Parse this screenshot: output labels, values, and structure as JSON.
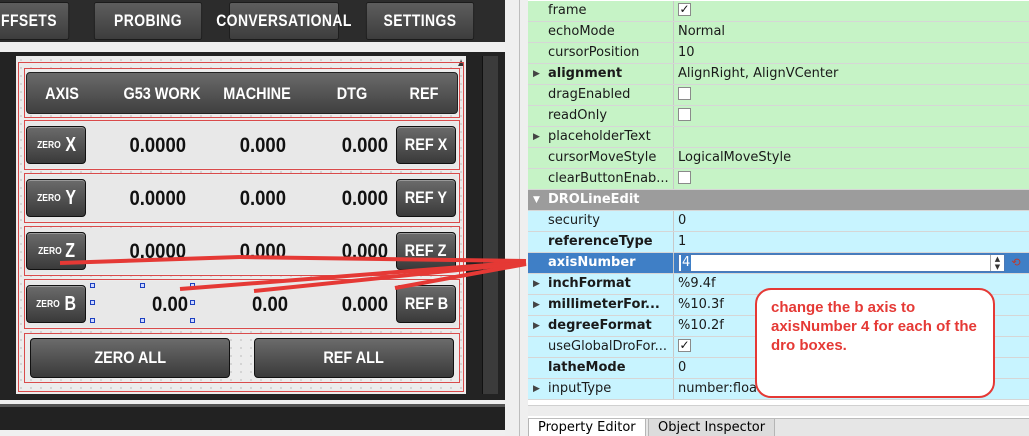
{
  "designer": {
    "tabs": [
      "FFSETS",
      "PROBING",
      "CONVERSATIONAL",
      "SETTINGS"
    ],
    "headers": [
      "AXIS",
      "G53 WORK",
      "MACHINE",
      "DTG",
      "REF"
    ],
    "rows": [
      {
        "zero_small": "ZERO",
        "zero_big": "X",
        "work": "0.0000",
        "machine": "0.000",
        "dtg": "0.000",
        "ref": "REF X"
      },
      {
        "zero_small": "ZERO",
        "zero_big": "Y",
        "work": "0.0000",
        "machine": "0.000",
        "dtg": "0.000",
        "ref": "REF Y"
      },
      {
        "zero_small": "ZERO",
        "zero_big": "Z",
        "work": "0.0000",
        "machine": "0.000",
        "dtg": "0.000",
        "ref": "REF Z"
      },
      {
        "zero_small": "ZERO",
        "zero_big": "B",
        "work": "0.00",
        "machine": "0.00",
        "dtg": "0.000",
        "ref": "REF B"
      }
    ],
    "zero_all": "ZERO ALL",
    "ref_all": "REF ALL"
  },
  "properties": {
    "rows": [
      {
        "name": "frame",
        "value": "",
        "check": "checked",
        "color": "green",
        "bold": false,
        "arrow": ""
      },
      {
        "name": "echoMode",
        "value": "Normal",
        "check": "",
        "color": "green",
        "bold": false,
        "arrow": ""
      },
      {
        "name": "cursorPosition",
        "value": "10",
        "check": "",
        "color": "green",
        "bold": false,
        "arrow": ""
      },
      {
        "name": "alignment",
        "value": "AlignRight, AlignVCenter",
        "check": "",
        "color": "green",
        "bold": true,
        "arrow": "▶"
      },
      {
        "name": "dragEnabled",
        "value": "",
        "check": "unchecked",
        "color": "green",
        "bold": false,
        "arrow": ""
      },
      {
        "name": "readOnly",
        "value": "",
        "check": "unchecked",
        "color": "green",
        "bold": false,
        "arrow": ""
      },
      {
        "name": "placeholderText",
        "value": "",
        "check": "",
        "color": "green",
        "bold": false,
        "arrow": "▶"
      },
      {
        "name": "cursorMoveStyle",
        "value": "LogicalMoveStyle",
        "check": "",
        "color": "green",
        "bold": false,
        "arrow": ""
      },
      {
        "name": "clearButtonEnab...",
        "value": "",
        "check": "unchecked",
        "color": "green",
        "bold": false,
        "arrow": ""
      }
    ],
    "group": "DROLineEdit",
    "group_rows": [
      {
        "name": "security",
        "value": "0",
        "check": "",
        "bold": false,
        "arrow": ""
      },
      {
        "name": "referenceType",
        "value": "1",
        "check": "",
        "bold": true,
        "arrow": ""
      }
    ],
    "selected": {
      "name": "axisNumber",
      "value": "4"
    },
    "after_rows": [
      {
        "name": "inchFormat",
        "value": "%9.4f",
        "check": "",
        "bold": true,
        "arrow": "▶"
      },
      {
        "name": "millimeterFor...",
        "value": "%10.3f",
        "check": "",
        "bold": true,
        "arrow": "▶"
      },
      {
        "name": "degreeFormat",
        "value": "%10.2f",
        "check": "",
        "bold": true,
        "arrow": "▶"
      },
      {
        "name": "useGlobalDroFor...",
        "value": "",
        "check": "checked",
        "bold": false,
        "arrow": ""
      },
      {
        "name": "latheMode",
        "value": "0",
        "check": "",
        "bold": true,
        "arrow": ""
      },
      {
        "name": "inputType",
        "value": "number:float",
        "check": "",
        "bold": false,
        "arrow": "▶"
      }
    ]
  },
  "annotation": "change the b axis to axisNumber 4 for each of the dro boxes.",
  "bottom_tabs": [
    "Property Editor",
    "Object Inspector"
  ],
  "colors": {
    "annotation_red": "#e53935",
    "selection_blue": "#3f7fc6",
    "green_rows": "#c6f3c6",
    "cyan_rows": "#c8f4ff"
  }
}
